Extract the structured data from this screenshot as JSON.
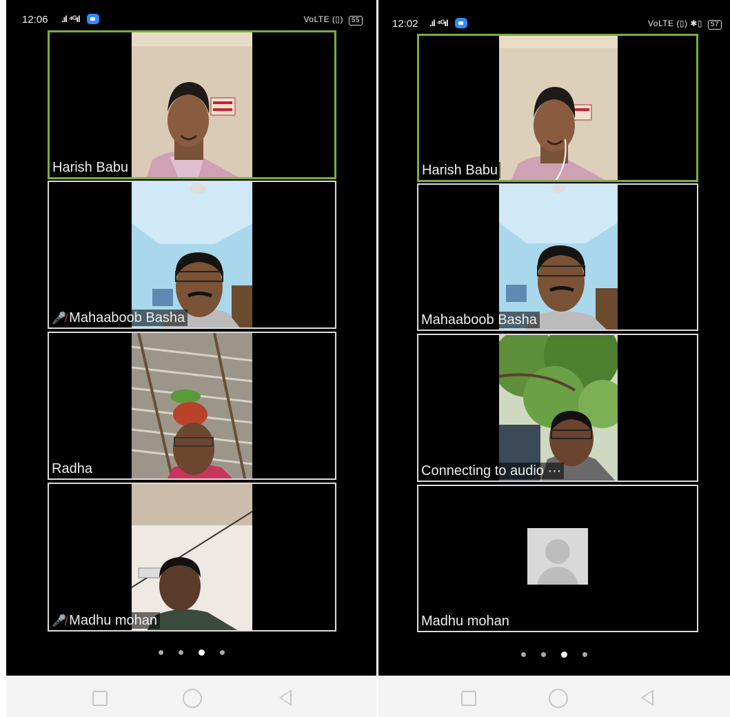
{
  "left_screen": {
    "status": {
      "time": "12:06",
      "signal": ".ıl ⁴ᴳıl",
      "network": "VoLTE",
      "battery": "55"
    },
    "tiles": [
      {
        "name": "Harish Babu",
        "muted": false
      },
      {
        "name": "Mahaaboob Basha",
        "muted": true
      },
      {
        "name": "Radha",
        "muted": false
      },
      {
        "name": "Madhu mohan",
        "muted": true
      }
    ],
    "page_dots": 4,
    "active_page": 3
  },
  "right_screen": {
    "status": {
      "time": "12:02",
      "signal": ".ıl ⁴ᴳıl",
      "network": "VoLTE",
      "battery": "57"
    },
    "tiles": [
      {
        "name": "Harish Babu"
      },
      {
        "name": "Mahaaboob Basha"
      },
      {
        "name": "Connecting to audio ···"
      },
      {
        "name": "Madhu mohan"
      }
    ],
    "page_dots": 4,
    "active_page": 3
  },
  "icons": {
    "mic_muted": "mic-muted-icon",
    "app": "zoom-app-icon",
    "nav": [
      "recent-apps-icon",
      "home-icon",
      "back-icon"
    ]
  },
  "colors": {
    "active_speaker_border": "#7cae3b",
    "tile_border": "#dcdcdc",
    "zoom_blue": "#2d8cff",
    "muted_mic": "#e33333"
  }
}
